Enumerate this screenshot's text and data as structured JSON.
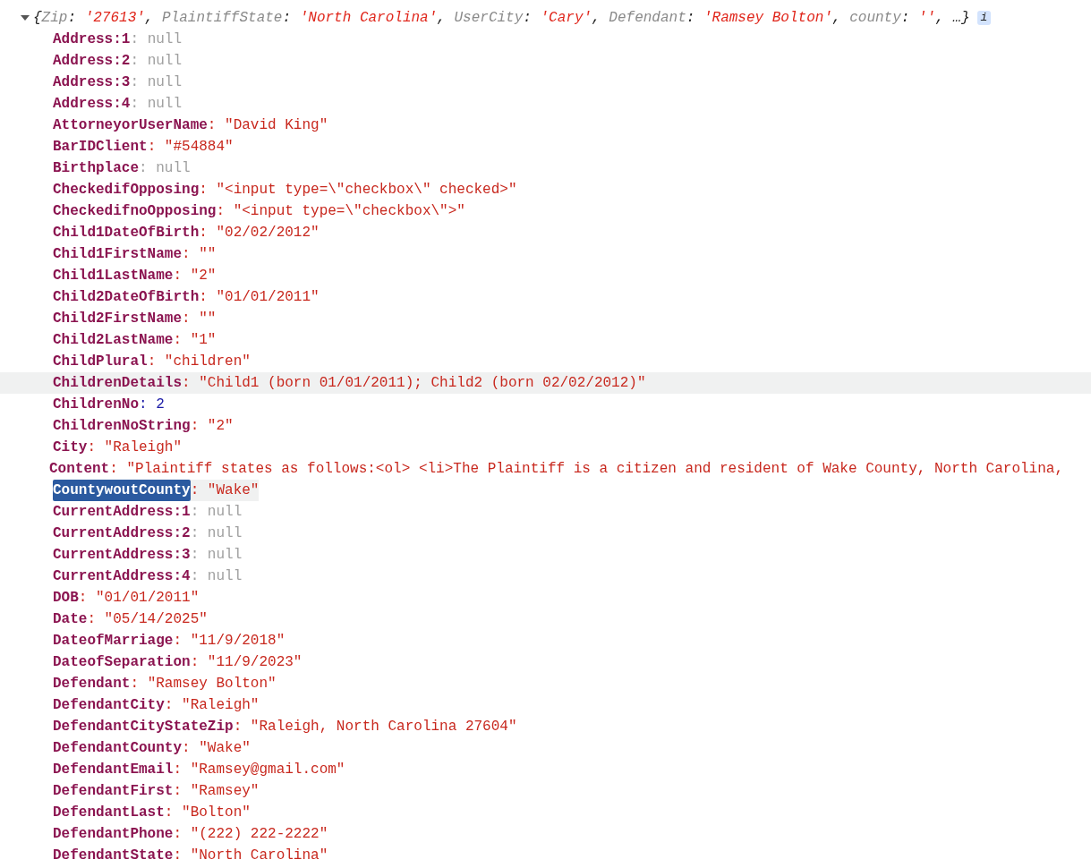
{
  "header": {
    "expanded": true,
    "open": "{",
    "separator": ": ",
    "comma": ", ",
    "tail": "…}",
    "info": "i",
    "preview": [
      {
        "key": "Zip",
        "value": "'27613'"
      },
      {
        "key": "PlaintiffState",
        "value": "'North Carolina'"
      },
      {
        "key": "UserCity",
        "value": "'Cary'"
      },
      {
        "key": "Defendant",
        "value": "'Ramsey Bolton'"
      },
      {
        "key": "county",
        "value": "''"
      }
    ]
  },
  "separator": ": ",
  "rows": [
    {
      "key": "Address:1",
      "value": "null",
      "kind": "null",
      "hovered": false,
      "key_selected": false
    },
    {
      "key": "Address:2",
      "value": "null",
      "kind": "null",
      "hovered": false,
      "key_selected": false
    },
    {
      "key": "Address:3",
      "value": "null",
      "kind": "null",
      "hovered": false,
      "key_selected": false
    },
    {
      "key": "Address:4",
      "value": "null",
      "kind": "null",
      "hovered": false,
      "key_selected": false
    },
    {
      "key": "AttorneyorUserName",
      "value": "\"David King\"",
      "kind": "string",
      "hovered": false,
      "key_selected": false
    },
    {
      "key": "BarIDClient",
      "value": "\"#54884\"",
      "kind": "string",
      "hovered": false,
      "key_selected": false
    },
    {
      "key": "Birthplace",
      "value": "null",
      "kind": "null",
      "hovered": false,
      "key_selected": false
    },
    {
      "key": "CheckedifOpposing",
      "value": "\"<input type=\\\"checkbox\\\" checked>\"",
      "kind": "string",
      "hovered": false,
      "key_selected": false
    },
    {
      "key": "CheckedifnoOpposing",
      "value": "\"<input type=\\\"checkbox\\\">\"",
      "kind": "string",
      "hovered": false,
      "key_selected": false
    },
    {
      "key": "Child1DateOfBirth",
      "value": "\"02/02/2012\"",
      "kind": "string",
      "hovered": false,
      "key_selected": false
    },
    {
      "key": "Child1FirstName",
      "value": "\"\"",
      "kind": "string",
      "hovered": false,
      "key_selected": false
    },
    {
      "key": "Child1LastName",
      "value": "\"2\"",
      "kind": "string",
      "hovered": false,
      "key_selected": false
    },
    {
      "key": "Child2DateOfBirth",
      "value": "\"01/01/2011\"",
      "kind": "string",
      "hovered": false,
      "key_selected": false
    },
    {
      "key": "Child2FirstName",
      "value": "\"\"",
      "kind": "string",
      "hovered": false,
      "key_selected": false
    },
    {
      "key": "Child2LastName",
      "value": "\"1\"",
      "kind": "string",
      "hovered": false,
      "key_selected": false
    },
    {
      "key": "ChildPlural",
      "value": "\"children\"",
      "kind": "string",
      "hovered": false,
      "key_selected": false
    },
    {
      "key": "ChildrenDetails",
      "value": "\"Child1 (born 01/01/2011); Child2 (born 02/02/2012)\"",
      "kind": "string",
      "hovered": true,
      "key_selected": false
    },
    {
      "key": "ChildrenNo",
      "value": "2",
      "kind": "number",
      "hovered": false,
      "key_selected": false
    },
    {
      "key": "ChildrenNoString",
      "value": "\"2\"",
      "kind": "string",
      "hovered": false,
      "key_selected": false
    },
    {
      "key": "City",
      "value": "\"Raleigh\"",
      "kind": "string",
      "hovered": false,
      "key_selected": false
    },
    {
      "key": "Content",
      "value": "\"Plaintiff states as follows:<ol> <li>The Plaintiff is a citizen and resident of Wake County, North Carolina,",
      "kind": "string",
      "hovered": false,
      "key_selected": false
    },
    {
      "key": "CountywoutCounty",
      "value": "\"Wake\"",
      "kind": "string",
      "hovered": false,
      "key_selected": true
    },
    {
      "key": "CurrentAddress:1",
      "value": "null",
      "kind": "null",
      "hovered": false,
      "key_selected": false
    },
    {
      "key": "CurrentAddress:2",
      "value": "null",
      "kind": "null",
      "hovered": false,
      "key_selected": false
    },
    {
      "key": "CurrentAddress:3",
      "value": "null",
      "kind": "null",
      "hovered": false,
      "key_selected": false
    },
    {
      "key": "CurrentAddress:4",
      "value": "null",
      "kind": "null",
      "hovered": false,
      "key_selected": false
    },
    {
      "key": "DOB",
      "value": "\"01/01/2011\"",
      "kind": "string",
      "hovered": false,
      "key_selected": false
    },
    {
      "key": "Date",
      "value": "\"05/14/2025\"",
      "kind": "string",
      "hovered": false,
      "key_selected": false
    },
    {
      "key": "DateofMarriage",
      "value": "\"11/9/2018\"",
      "kind": "string",
      "hovered": false,
      "key_selected": false
    },
    {
      "key": "DateofSeparation",
      "value": "\"11/9/2023\"",
      "kind": "string",
      "hovered": false,
      "key_selected": false
    },
    {
      "key": "Defendant",
      "value": "\"Ramsey Bolton\"",
      "kind": "string",
      "hovered": false,
      "key_selected": false
    },
    {
      "key": "DefendantCity",
      "value": "\"Raleigh\"",
      "kind": "string",
      "hovered": false,
      "key_selected": false
    },
    {
      "key": "DefendantCityStateZip",
      "value": "\"Raleigh, North Carolina 27604\"",
      "kind": "string",
      "hovered": false,
      "key_selected": false
    },
    {
      "key": "DefendantCounty",
      "value": "\"Wake\"",
      "kind": "string",
      "hovered": false,
      "key_selected": false
    },
    {
      "key": "DefendantEmail",
      "value": "\"Ramsey@gmail.com\"",
      "kind": "string",
      "hovered": false,
      "key_selected": false
    },
    {
      "key": "DefendantFirst",
      "value": "\"Ramsey\"",
      "kind": "string",
      "hovered": false,
      "key_selected": false
    },
    {
      "key": "DefendantLast",
      "value": "\"Bolton\"",
      "kind": "string",
      "hovered": false,
      "key_selected": false
    },
    {
      "key": "DefendantPhone",
      "value": "\"(222) 222-2222\"",
      "kind": "string",
      "hovered": false,
      "key_selected": false
    },
    {
      "key": "DefendantState",
      "value": "\"North Carolina\"",
      "kind": "string",
      "hovered": false,
      "key_selected": false
    }
  ]
}
